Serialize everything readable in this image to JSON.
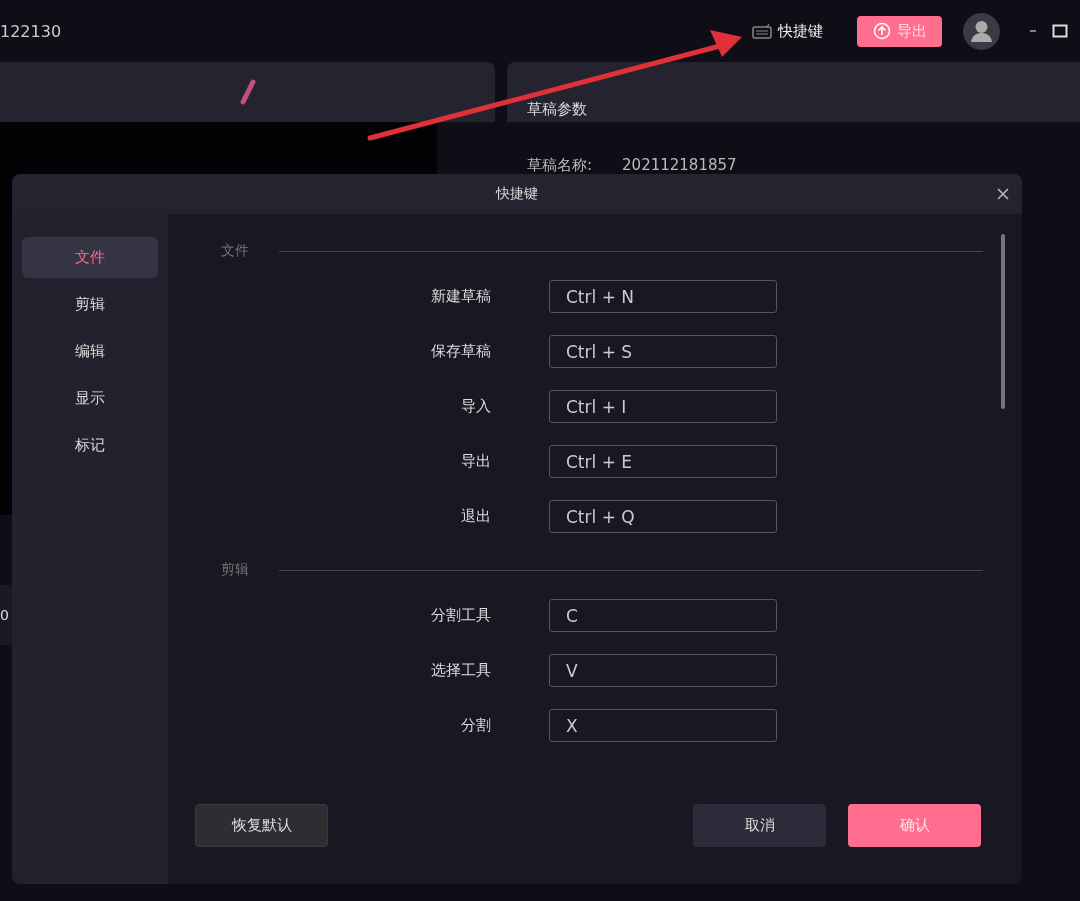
{
  "window": {
    "title": "122130",
    "shortcut_link": "快捷键",
    "export_button": "导出"
  },
  "preview_panel": {
    "timecode": "0"
  },
  "draft_panel": {
    "title": "草稿参数",
    "fields": [
      {
        "label": "草稿名称:",
        "value": "202112181857"
      }
    ]
  },
  "dialog": {
    "title": "快捷键",
    "sidebar": [
      {
        "label": "文件",
        "selected": true
      },
      {
        "label": "剪辑",
        "selected": false
      },
      {
        "label": "编辑",
        "selected": false
      },
      {
        "label": "显示",
        "selected": false
      },
      {
        "label": "标记",
        "selected": false
      }
    ],
    "sections": [
      {
        "heading": "文件",
        "rows": [
          {
            "label": "新建草稿",
            "keys": "Ctrl + N"
          },
          {
            "label": "保存草稿",
            "keys": "Ctrl + S"
          },
          {
            "label": "导入",
            "keys": "Ctrl + I"
          },
          {
            "label": "导出",
            "keys": "Ctrl + E"
          },
          {
            "label": "退出",
            "keys": "Ctrl + Q"
          }
        ]
      },
      {
        "heading": "剪辑",
        "rows": [
          {
            "label": "分割工具",
            "keys": "C"
          },
          {
            "label": "选择工具",
            "keys": "V"
          },
          {
            "label": "分割",
            "keys": "X"
          }
        ]
      }
    ],
    "buttons": {
      "reset": "恢复默认",
      "cancel": "取消",
      "confirm": "确认"
    }
  }
}
